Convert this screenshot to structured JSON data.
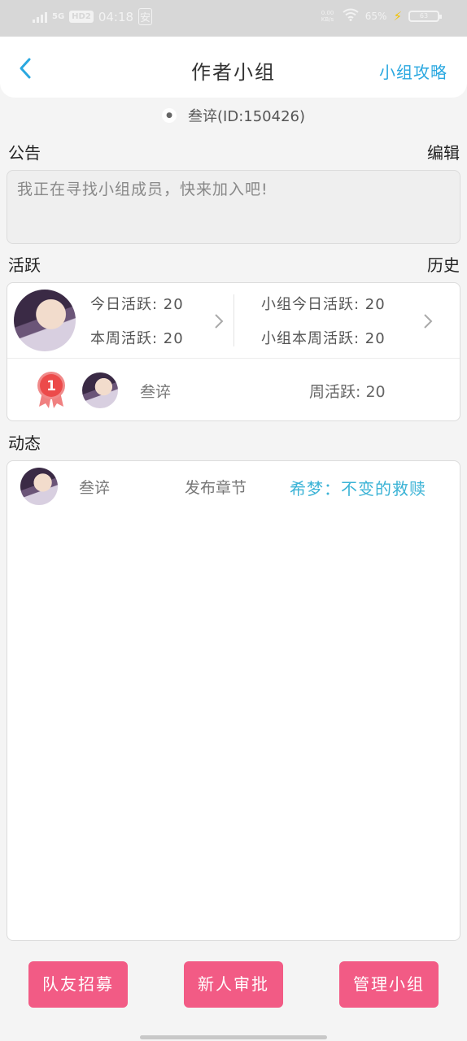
{
  "status_bar": {
    "network": "5G",
    "hd": "HD2",
    "time": "04:18",
    "app_indicator": "安",
    "speed": "0.00 KB/s",
    "battery_text": "65%",
    "battery_level": "63"
  },
  "navbar": {
    "title": "作者小组",
    "right_link": "小组攻略",
    "back_icon": "chevron-left-icon",
    "accent_color": "#2aa8e0"
  },
  "owner": {
    "text": "叁谇(ID:150426)"
  },
  "notice": {
    "section_title": "公告",
    "edit_label": "编辑",
    "content": "我正在寻找小组成员，快来加入吧!"
  },
  "activity": {
    "section_title": "活跃",
    "history_label": "历史",
    "personal": {
      "today": "今日活跃:  20",
      "week": "本周活跃:  20"
    },
    "group": {
      "today": "小组今日活跃:  20",
      "week": "小组本周活跃:  20"
    },
    "ranking": {
      "rank": "1",
      "name": "叁谇",
      "week_active": "周活跃:  20"
    }
  },
  "feed": {
    "section_title": "动态",
    "items": [
      {
        "user": "叁谇",
        "action": "发布章节",
        "target": "希梦：不变的救赎"
      }
    ]
  },
  "buttons": {
    "recruit": "队友招募",
    "approve": "新人审批",
    "manage": "管理小组",
    "color": "#f25b85"
  }
}
